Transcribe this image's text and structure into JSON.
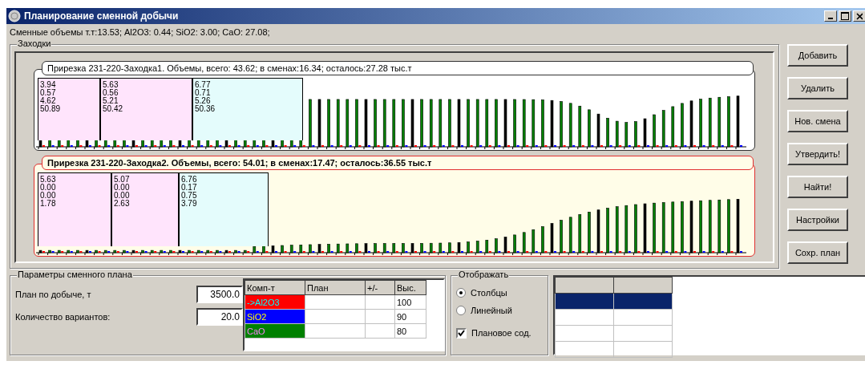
{
  "window": {
    "title": "Планирование сменной добычи"
  },
  "summary": "Сменные объемы т.т:13.53; Al2O3: 0.44; SiO2: 3.00; CaO: 27.08;",
  "group": {
    "title": "Заходки"
  },
  "panels": [
    {
      "title": "Прирезка 231-220-Заходка1. Объемы, всего: 43.62; в сменах:16.34; осталось:27.28 тыс.т",
      "selected": false,
      "kind": "steady",
      "segments": [
        {
          "values": [
            "3.94",
            "0.57",
            "4.62",
            "50.89"
          ],
          "color": "#ffe4fc"
        },
        {
          "values": [
            "5.63",
            "0.56",
            "5.21",
            "50.42"
          ],
          "color": "#ffe4fc"
        },
        {
          "values": [
            "6.77",
            "0.71",
            "5.26",
            "50.36"
          ],
          "color": "#e4fcfc"
        }
      ]
    },
    {
      "title": "Прирезка 231-220-Заходка2. Объемы, всего: 54.01; в сменах:17.47; осталось:36.55 тыс.т",
      "selected": true,
      "kind": "rising",
      "segments": [
        {
          "values": [
            "5.63",
            "0.00",
            "0.00",
            "1.78"
          ],
          "color": "#ffe4fc"
        },
        {
          "values": [
            "5.07",
            "0.00",
            "0.00",
            "2.63"
          ],
          "color": "#ffe4fc"
        },
        {
          "values": [
            "6.76",
            "0.17",
            "0.75",
            "3.79"
          ],
          "color": "#e4fcfc"
        }
      ]
    }
  ],
  "buttons": [
    "Добавить",
    "Удалить",
    "Нов. смена",
    "Утвердить!",
    "Найти!",
    "Настройки",
    "Сохр. план"
  ],
  "params": {
    "title": "Параметры сменного плана",
    "fields": [
      {
        "label": "План по добыче, т",
        "value": "3500.0"
      },
      {
        "label": "Количество вариантов:",
        "value": "20.0"
      }
    ],
    "table": {
      "columns": [
        "Комп-т",
        "План",
        "+/-",
        "Выс."
      ],
      "rows": [
        {
          "component": "->Al2O3",
          "color": "#ff0000",
          "value": "100"
        },
        {
          "component": "SiO2",
          "color": "#0000ff",
          "value": "90"
        },
        {
          "component": "CaO",
          "color": "#008000",
          "value": "80"
        }
      ]
    }
  },
  "display": {
    "title": "Отображать",
    "options": [
      {
        "label": "Столбцы",
        "selected": true
      },
      {
        "label": "Линейный",
        "selected": false
      }
    ],
    "checkbox": {
      "label": "Плановое сод.",
      "checked": true
    }
  },
  "grid": {
    "rows": [
      {
        "selected": true
      },
      {
        "selected": false
      },
      {
        "selected": false
      },
      {
        "selected": false
      }
    ]
  }
}
